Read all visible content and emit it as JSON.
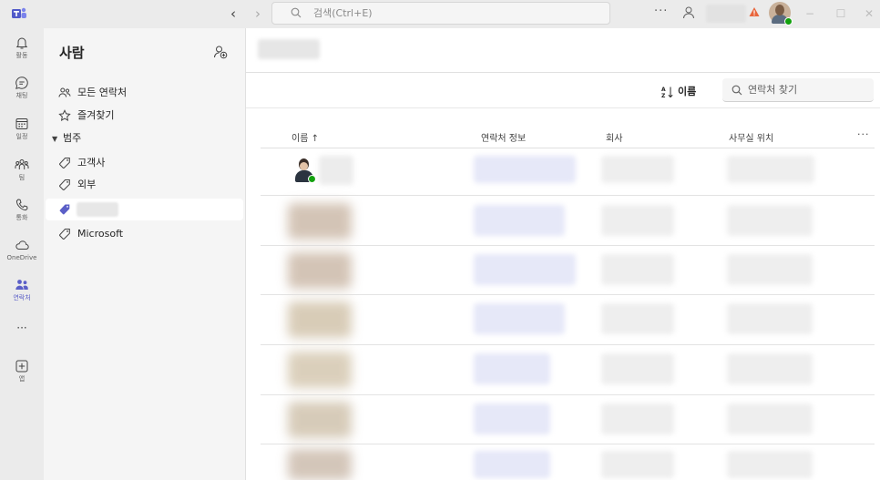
{
  "titlebar": {
    "search_placeholder": "검색(Ctrl+E)",
    "back_glyph": "‹",
    "forward_glyph": "›",
    "more_glyph": "···",
    "minimize_glyph": "−",
    "maximize_glyph": "☐",
    "close_glyph": "✕"
  },
  "rail": {
    "items": [
      {
        "label": "활동",
        "icon": "bell-icon"
      },
      {
        "label": "채팅",
        "icon": "chat-icon"
      },
      {
        "label": "일정",
        "icon": "calendar-icon"
      },
      {
        "label": "팀",
        "icon": "teams-icon"
      },
      {
        "label": "통화",
        "icon": "phone-icon"
      },
      {
        "label": "OneDrive",
        "icon": "cloud-icon"
      },
      {
        "label": "연락처",
        "icon": "people-icon"
      },
      {
        "label": "···",
        "icon": "more-icon"
      },
      {
        "label": "앱",
        "icon": "add-app-icon"
      }
    ]
  },
  "panel": {
    "title": "사람",
    "items": [
      {
        "label": "모든 연락처"
      },
      {
        "label": "즐겨찾기"
      },
      {
        "label": "범주"
      },
      {
        "label": "고객사"
      },
      {
        "label": "외부"
      },
      {
        "label": "Microsoft"
      }
    ]
  },
  "main": {
    "sort_label": "이름",
    "find_placeholder": "연락처 찾기",
    "columns": [
      "이름 ↑",
      "연락처 정보",
      "회사",
      "사무실 위치"
    ],
    "more_glyph": "···"
  },
  "colors": {
    "accent": "#5b5fc7",
    "presence": "#13a10e",
    "warning": "#e8663d"
  }
}
